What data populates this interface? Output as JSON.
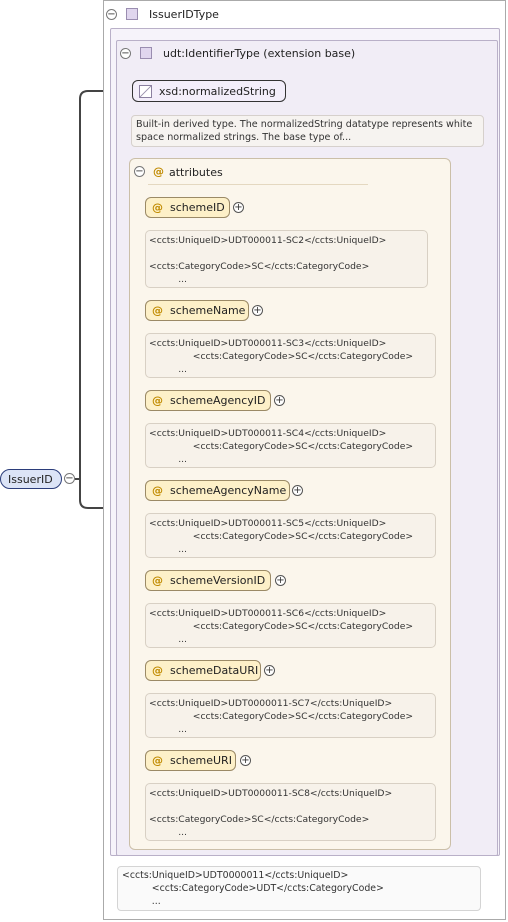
{
  "type_title": "IssuerIDType",
  "extension_title": "udt:IdentifierType (extension base)",
  "base_type": "xsd:normalizedString",
  "base_doc": "Built-in derived type. The normalizedString datatype represents white space normalized strings. The base type of...",
  "attributes_title": "attributes",
  "element_name": "IssuerID",
  "attributes": [
    {
      "name": "schemeID",
      "doc": "<ccts:UniqueID>UDT000011-SC2</ccts:UniqueID>\n\n<ccts:CategoryCode>SC</ccts:CategoryCode>\n          ..."
    },
    {
      "name": "schemeName",
      "doc": "<ccts:UniqueID>UDT000011-SC3</ccts:UniqueID>\n               <ccts:CategoryCode>SC</ccts:CategoryCode>\n          ..."
    },
    {
      "name": "schemeAgencyID",
      "doc": "<ccts:UniqueID>UDT000011-SC4</ccts:UniqueID>\n               <ccts:CategoryCode>SC</ccts:CategoryCode>\n          ..."
    },
    {
      "name": "schemeAgencyName",
      "doc": "<ccts:UniqueID>UDT000011-SC5</ccts:UniqueID>\n               <ccts:CategoryCode>SC</ccts:CategoryCode>\n          ..."
    },
    {
      "name": "schemeVersionID",
      "doc": "<ccts:UniqueID>UDT000011-SC6</ccts:UniqueID>\n               <ccts:CategoryCode>SC</ccts:CategoryCode>\n          ..."
    },
    {
      "name": "schemeDataURI",
      "doc": "<ccts:UniqueID>UDT0000011-SC7</ccts:UniqueID>\n               <ccts:CategoryCode>SC</ccts:CategoryCode>\n          ..."
    },
    {
      "name": "schemeURI",
      "doc": "<ccts:UniqueID>UDT0000011-SC8</ccts:UniqueID>\n\n<ccts:CategoryCode>SC</ccts:CategoryCode>\n          ..."
    }
  ],
  "element_doc": "<ccts:UniqueID>UDT0000011</ccts:UniqueID>\n          <ccts:CategoryCode>UDT</ccts:CategoryCode>\n          ...",
  "icons": {
    "collapse": "−",
    "expand": "+",
    "attribute": "@"
  }
}
